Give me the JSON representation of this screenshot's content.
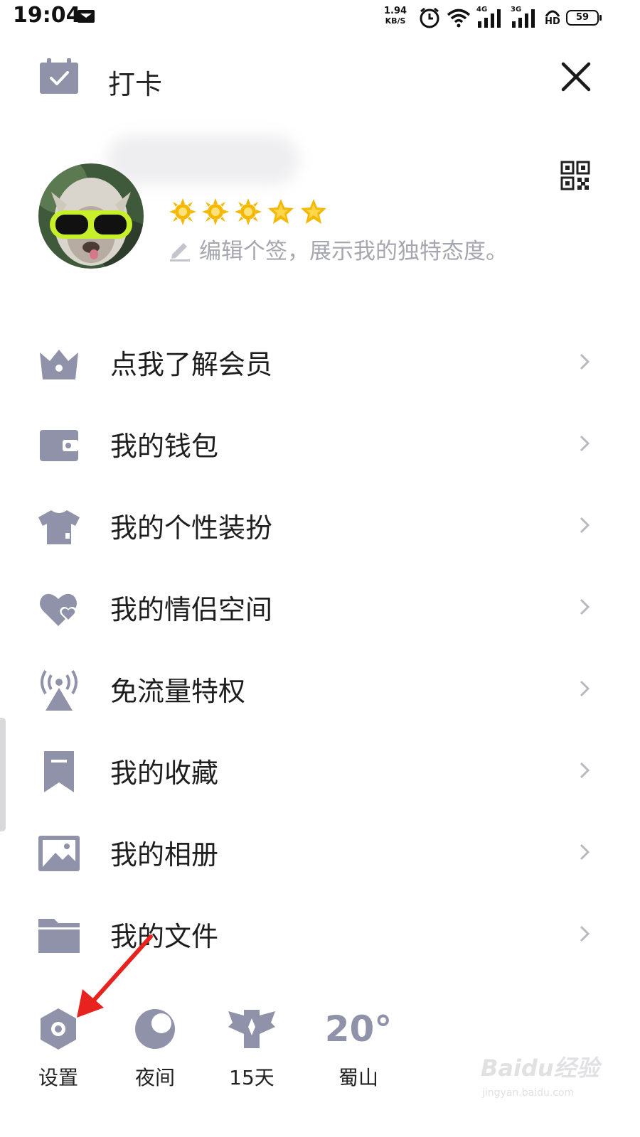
{
  "status_bar": {
    "time": "19:04",
    "speed_value": "1.94",
    "speed_unit": "KB/S",
    "net1": "4G",
    "net2": "3G",
    "hd": "HD",
    "battery": "59"
  },
  "header": {
    "checkin_label": "打卡",
    "close_icon": "close-icon"
  },
  "profile": {
    "signature_placeholder": "编辑个签，展示我的独特态度。",
    "level_icons": [
      "sun-icon",
      "sun-icon",
      "sun-icon",
      "star-icon",
      "star-icon"
    ]
  },
  "menu": {
    "items": [
      {
        "label": "点我了解会员",
        "icon": "crown-icon"
      },
      {
        "label": "我的钱包",
        "icon": "wallet-icon"
      },
      {
        "label": "我的个性装扮",
        "icon": "tshirt-icon"
      },
      {
        "label": "我的情侣空间",
        "icon": "hearts-icon"
      },
      {
        "label": "免流量特权",
        "icon": "antenna-icon"
      },
      {
        "label": "我的收藏",
        "icon": "bookmark-icon"
      },
      {
        "label": "我的相册",
        "icon": "photo-icon"
      },
      {
        "label": "我的文件",
        "icon": "folder-icon"
      }
    ]
  },
  "bottom_bar": {
    "settings": "设置",
    "night": "夜间",
    "days": "15天",
    "temperature": "20°",
    "city": "蜀山"
  },
  "watermark": {
    "logo": "Baidu经验",
    "url": "jingyan.baidu.com"
  },
  "colors": {
    "icon_gray": "#8f92a8",
    "text": "#1e1e1e",
    "placeholder": "#a6a6b0",
    "annotation_arrow": "#e8231f",
    "star_gold": "#f5b800"
  }
}
